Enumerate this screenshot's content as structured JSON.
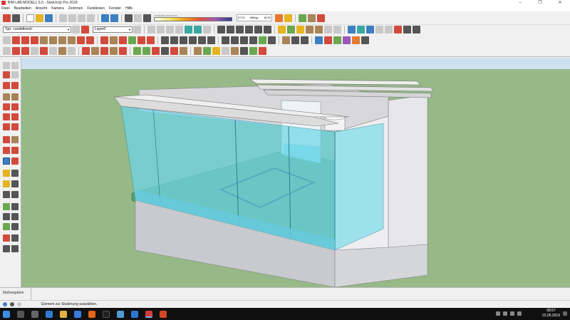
{
  "window": {
    "title": "BIM LAB MODELL 6.0 - SketchUp Pro 2018",
    "minimize": "–",
    "maximize": "❐",
    "close": "✕"
  },
  "menu": [
    "Datei",
    "Bearbeiten",
    "Ansicht",
    "Kamera",
    "Zeichnen",
    "Funktionen",
    "Fenster",
    "Hilfe"
  ],
  "toolbar": {
    "shadow_months": "J F M A M J J A S O N D",
    "time_start": "07:21",
    "time_mid": "Mittag",
    "time_end": "16:32",
    "type_dropdown": "Typ: <undefined>",
    "layer_dropdown": "Layer0"
  },
  "measure_panel": {
    "label": "Maßangaben"
  },
  "status": {
    "message": "Element zur Skalierung auswählen."
  },
  "taskbar": {
    "time": "08:57",
    "date": "22.05.2019"
  },
  "colors": {
    "ground": "#96b987",
    "sky": "#d0e3f0",
    "wall": "#e3e3e5",
    "glass": "#6fd6e8",
    "taskbar": "#101010"
  }
}
